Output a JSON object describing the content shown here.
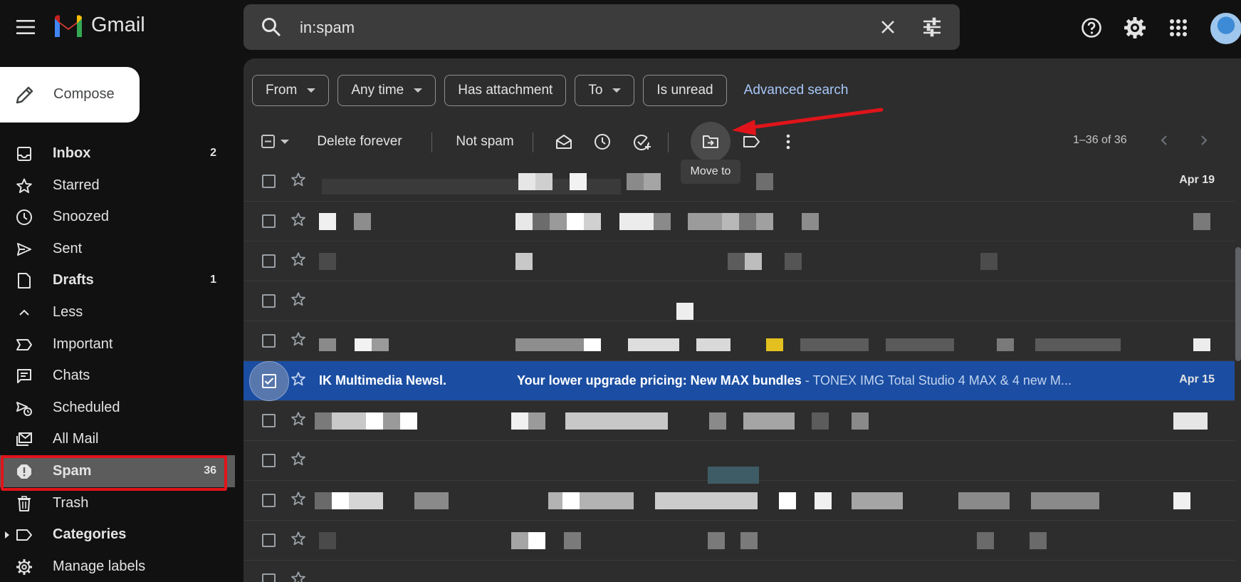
{
  "app": {
    "name": "Gmail",
    "search_query": "in:spam"
  },
  "sidebar": {
    "compose_label": "Compose",
    "items": [
      {
        "label": "Inbox",
        "count": "2",
        "icon": "inbox-icon",
        "bold": true
      },
      {
        "label": "Starred",
        "count": "",
        "icon": "star-icon",
        "bold": false
      },
      {
        "label": "Snoozed",
        "count": "",
        "icon": "clock-icon",
        "bold": false
      },
      {
        "label": "Sent",
        "count": "",
        "icon": "send-icon",
        "bold": false
      },
      {
        "label": "Drafts",
        "count": "1",
        "icon": "draft-icon",
        "bold": true
      },
      {
        "label": "Less",
        "count": "",
        "icon": "chevron-up-icon",
        "bold": false
      },
      {
        "label": "Important",
        "count": "",
        "icon": "important-icon",
        "bold": false
      },
      {
        "label": "Chats",
        "count": "",
        "icon": "chat-icon",
        "bold": false
      },
      {
        "label": "Scheduled",
        "count": "",
        "icon": "scheduled-send-icon",
        "bold": false
      },
      {
        "label": "All Mail",
        "count": "",
        "icon": "all-mail-icon",
        "bold": false
      },
      {
        "label": "Spam",
        "count": "36",
        "icon": "spam-icon",
        "bold": true,
        "active": true
      },
      {
        "label": "Trash",
        "count": "",
        "icon": "trash-icon",
        "bold": false
      },
      {
        "label": "Categories",
        "count": "",
        "icon": "label-icon",
        "bold": true
      },
      {
        "label": "Manage labels",
        "count": "",
        "icon": "gear-icon",
        "bold": false
      }
    ]
  },
  "filters": {
    "chips": [
      "From",
      "Any time",
      "Has attachment",
      "To",
      "Is unread"
    ],
    "advanced_search": "Advanced search"
  },
  "toolbar": {
    "delete_forever": "Delete forever",
    "not_spam": "Not spam",
    "move_to_tooltip": "Move to",
    "pagination": "1–36 of 36"
  },
  "emails": {
    "first_date": "Apr 19",
    "selected": {
      "sender": "IK Multimedia Newsl.",
      "subject": "Your lower upgrade pricing: New MAX bundles",
      "snippet": " - TONEX IMG Total Studio 4 MAX & 4 new M...",
      "date": "Apr 15"
    }
  },
  "colors": {
    "background": "#111111",
    "panel": "#2d2d2d",
    "selected_row": "#1b4ea2",
    "spam_active": "#5c5c5c",
    "annotation_red": "#e0141a",
    "link": "#a8c7fa"
  }
}
